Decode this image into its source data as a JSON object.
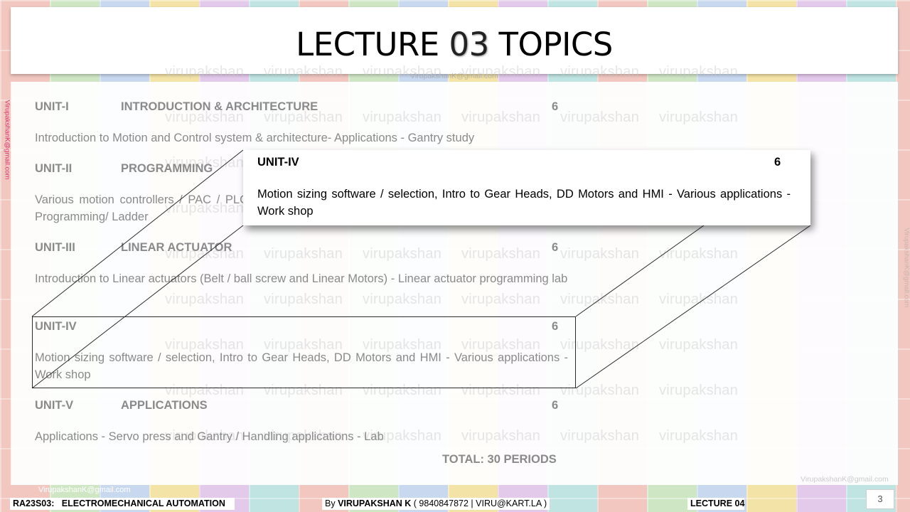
{
  "slide": {
    "title_prefix": "LECTURE ",
    "title_number": "03",
    "title_suffix": " TOPICS"
  },
  "units": [
    {
      "label": "UNIT-I",
      "title": "INTRODUCTION & ARCHITECTURE",
      "hours": "6",
      "description": "Introduction to Motion and Control system & architecture- Applications - Gantry study"
    },
    {
      "label": "UNIT-II",
      "title": "PROGRAMMING",
      "hours": "",
      "description": "Various motion controllers / PAC / PLC Programming/ Ladder"
    },
    {
      "label": "UNIT-III",
      "title": "LINEAR ACTUATOR",
      "hours": "6",
      "description": "Introduction to Linear actuators (Belt / ball screw and Linear Motors) - Linear actuator programming lab"
    },
    {
      "label": "UNIT-IV",
      "title": "",
      "hours": "6",
      "description": "Motion sizing software / selection, Intro to Gear Heads, DD Motors and HMI - Various applications - Work shop"
    },
    {
      "label": "UNIT-V",
      "title": "APPLICATIONS",
      "hours": "6",
      "description": "Applications - Servo press and Gantry / Handling applications - Lab"
    }
  ],
  "total": "TOTAL: 30 PERIODS",
  "callout": {
    "label": "UNIT-IV",
    "hours": "6",
    "description": "Motion sizing software / selection, Intro to Gear Heads, DD Motors and HMI - Various applications - Work shop"
  },
  "watermark": {
    "word": "virupakshan",
    "email": "VirupakshanK@gmail.com"
  },
  "footer": {
    "email": "VirupakshanK@gmail.com",
    "course_code": "RA23S03:",
    "course_name": "ELECTROMECHANICAL AUTOMATION",
    "by_label": "By ",
    "author": "VIRUPAKSHAN K",
    "contact": " ( 9840847872 | VIRU@KART.LA )",
    "lecture": "LECTURE 04",
    "page_number": "3"
  },
  "colors": {
    "body_text": "#8a8a8a",
    "callout_text": "#000000",
    "side_email": "#d6336c"
  }
}
